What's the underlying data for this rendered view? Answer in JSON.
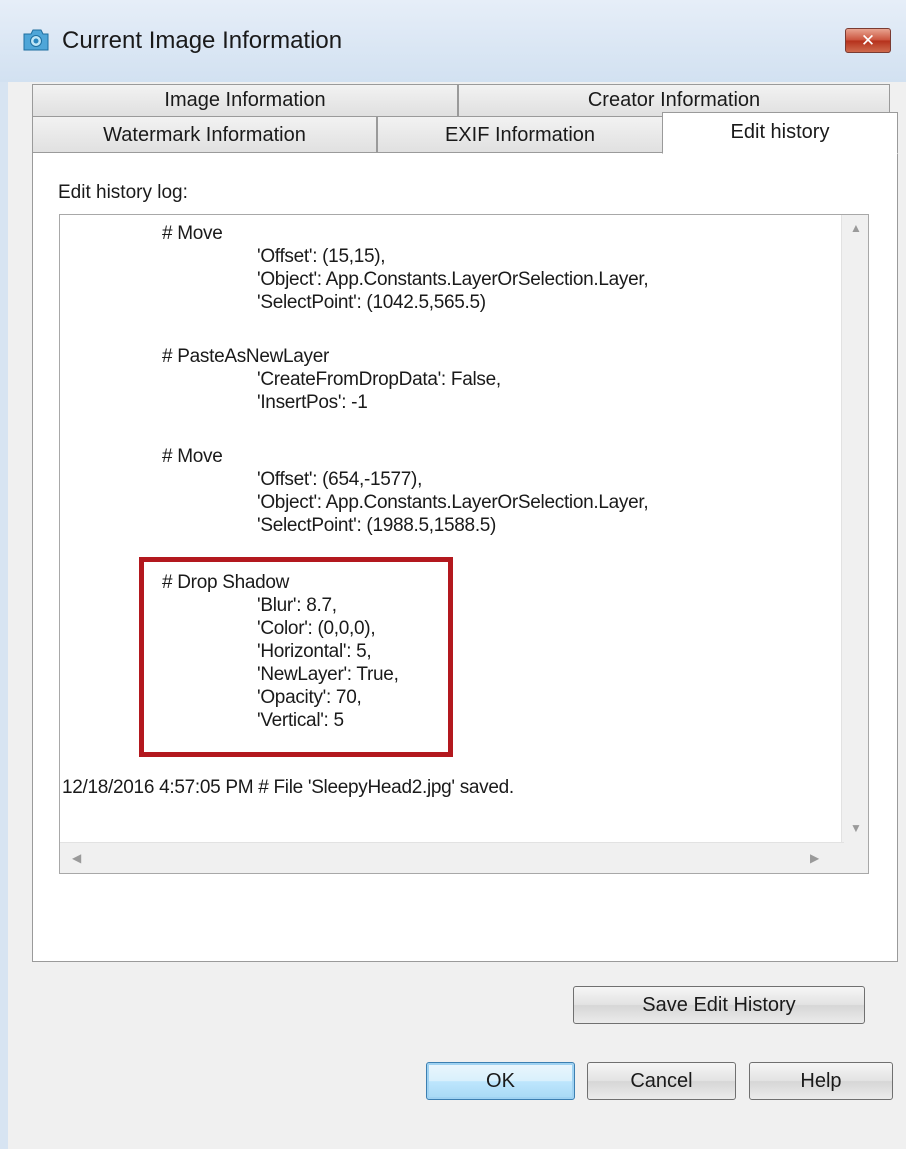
{
  "window": {
    "title": "Current Image Information",
    "close_label": "✕"
  },
  "tabs": {
    "row1": [
      {
        "label": "Image Information"
      },
      {
        "label": "Creator Information"
      }
    ],
    "row2": [
      {
        "label": "Watermark Information"
      },
      {
        "label": "EXIF Information"
      },
      {
        "label": "Edit history",
        "active": true
      }
    ]
  },
  "edit_history": {
    "label": "Edit history log:",
    "lines": [
      "# Move",
      "'Offset': (15,15),",
      "'Object': App.Constants.LayerOrSelection.Layer,",
      "'SelectPoint': (1042.5,565.5)",
      "# PasteAsNewLayer",
      "'CreateFromDropData': False,",
      "'InsertPos': -1",
      "# Move",
      "'Offset': (654,-1577),",
      "'Object': App.Constants.LayerOrSelection.Layer,",
      "'SelectPoint': (1988.5,1588.5)",
      "# Drop Shadow",
      "'Blur': 8.7,",
      "'Color': (0,0,0),",
      "'Horizontal': 5,",
      "'NewLayer': True,",
      "'Opacity': 70,",
      "'Vertical': 5",
      "12/18/2016 4:57:05 PM # File 'SleepyHead2.jpg' saved."
    ],
    "highlight_color": "#b3181e"
  },
  "buttons": {
    "save_edit_history": "Save Edit History",
    "ok": "OK",
    "cancel": "Cancel",
    "help": "Help"
  },
  "colors": {
    "title_bar": "#d7e4f2",
    "close_button": "#c9503a",
    "default_button": "#bee6fd"
  }
}
